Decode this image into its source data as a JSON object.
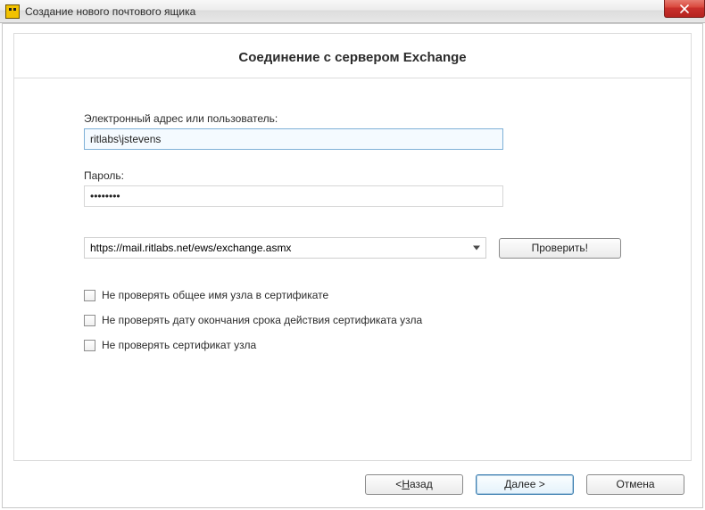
{
  "window": {
    "title": "Создание нового почтового ящика"
  },
  "panel": {
    "heading": "Соединение с сервером Exchange"
  },
  "fields": {
    "email_label": "Электронный адрес или пользователь:",
    "email_value": "ritlabs\\jstevens",
    "password_label": "Пароль:",
    "password_value": "••••••••",
    "url_value": "https://mail.ritlabs.net/ews/exchange.asmx"
  },
  "buttons": {
    "verify": "Проверить!",
    "back_prefix": "<   ",
    "back_accel": "Н",
    "back_suffix": "азад",
    "next_accel": "Д",
    "next_suffix": "алее   >",
    "cancel": "Отмена"
  },
  "checks": {
    "c1": "Не проверять общее имя узла в сертификате",
    "c2": "Не проверять дату окончания срока действия сертификата узла",
    "c3": "Не проверять сертификат узла"
  }
}
